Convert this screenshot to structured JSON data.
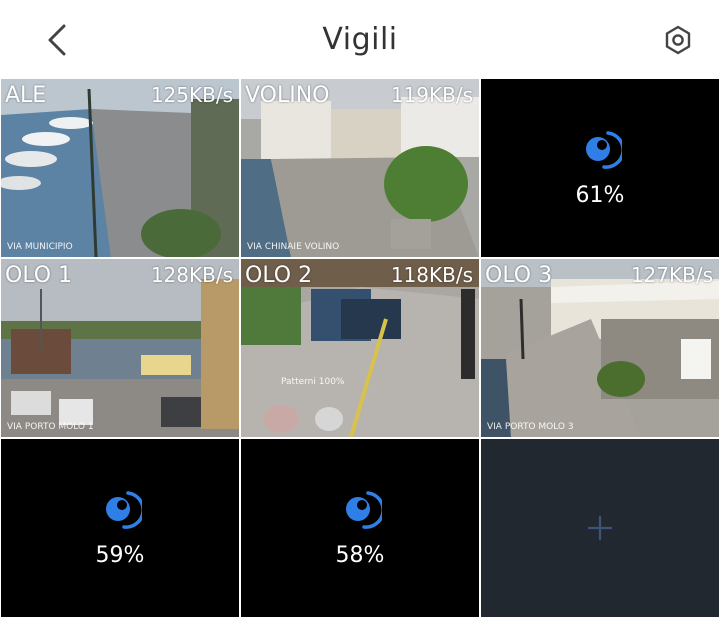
{
  "header": {
    "title": "Vigili",
    "back_icon": "chevron-left-icon",
    "settings_icon": "gear-icon"
  },
  "cameras": [
    {
      "name": "ALE",
      "rate": "125KB/s",
      "caption": "VIA MUNICIPIO",
      "state": "live",
      "selected": true
    },
    {
      "name": "VOLINO",
      "rate": "119KB/s",
      "caption": "VIA CHINAIE VOLINO",
      "state": "live"
    },
    {
      "state": "loading",
      "progress": "61%"
    },
    {
      "name": "OLO 1",
      "rate": "128KB/s",
      "caption": "VIA PORTO MOLO 1",
      "state": "live"
    },
    {
      "name": "OLO 2",
      "rate": "118KB/s",
      "caption": "Patterni 100%",
      "state": "live"
    },
    {
      "name": "OLO 3",
      "rate": "127KB/s",
      "caption": "VIA PORTO MOLO 3",
      "state": "live"
    },
    {
      "state": "loading",
      "progress": "59%"
    },
    {
      "state": "loading",
      "progress": "58%"
    },
    {
      "state": "empty",
      "icon": "plus-icon"
    }
  ],
  "colors": {
    "accent": "#2f7fe6",
    "selected_border": "#5aa6ef",
    "empty_bg": "#22282f"
  }
}
